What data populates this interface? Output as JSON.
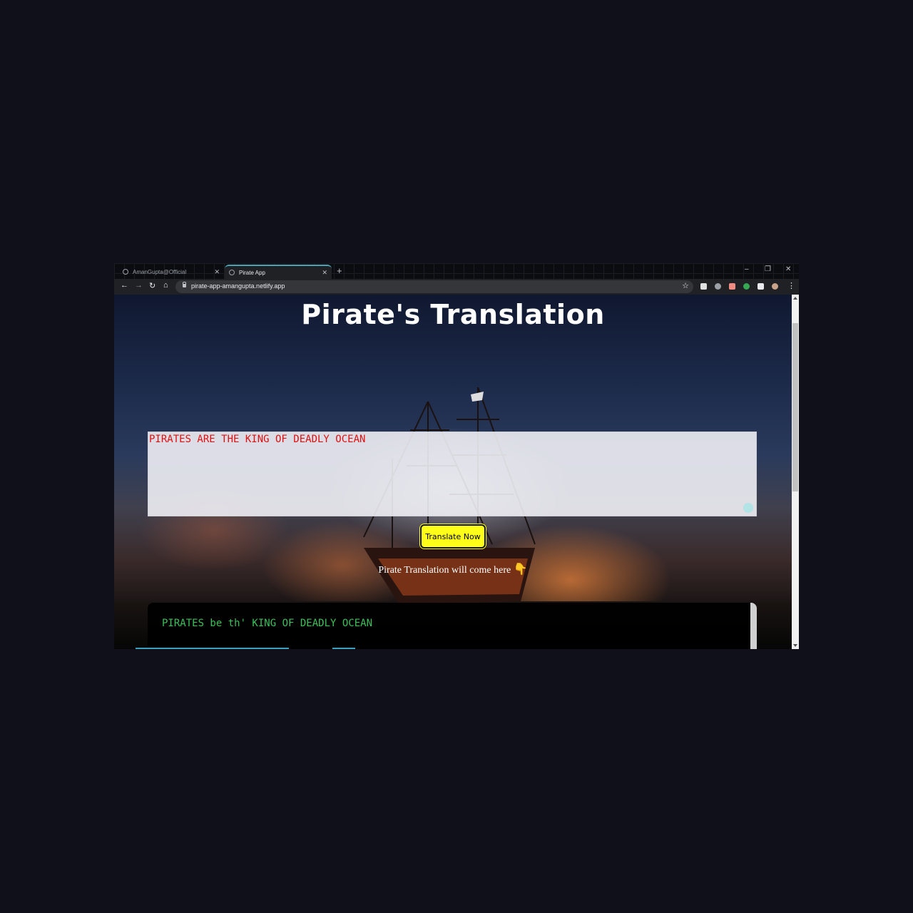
{
  "browser": {
    "tabs": [
      {
        "title": "AmanGupta@Official",
        "active": false
      },
      {
        "title": "Pirate App",
        "active": true
      }
    ],
    "new_tab_icon": "+",
    "url": "pirate-app-amangupta.netlify.app",
    "window_controls": {
      "minimize": "–",
      "maximize": "❐",
      "close": "✕"
    },
    "extension_colors": [
      "#e0e0e0",
      "#9aa0a6",
      "#f28b82",
      "#34a853",
      "#e8eaed"
    ]
  },
  "page": {
    "title": "Pirate's Translation",
    "input_text": "PIRATES ARE THE KING OF DEADLY OCEAN",
    "button_label": "Translate Now",
    "hint_text": "Pirate Translation will come here",
    "hint_icon": "👇",
    "output_text": "PIRATES be th' KING OF DEADLY OCEAN"
  },
  "colors": {
    "input_text": "#e01010",
    "output_text": "#3cc05a",
    "button_bg": "#ffff1a",
    "tab_accent": "#4aa3b5"
  }
}
